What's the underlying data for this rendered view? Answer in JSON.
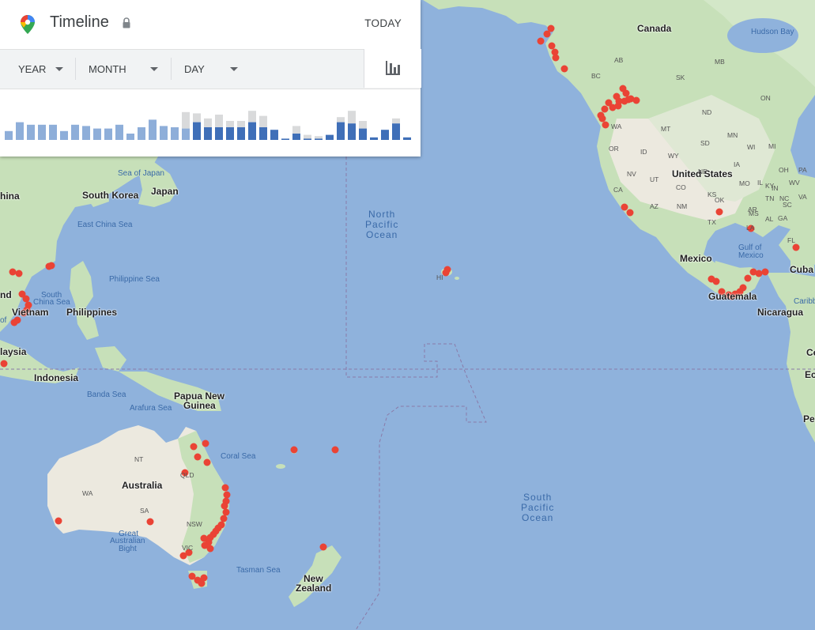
{
  "header": {
    "title": "Timeline",
    "today_label": "TODAY"
  },
  "filters": {
    "year": "YEAR",
    "month": "MONTH",
    "day": "DAY"
  },
  "colors": {
    "ocean": "#8fb2dc",
    "land": "#c7e0b9",
    "land_dry": "#ece9df",
    "marker": "#ea4335",
    "bar_dark": "#3f6fb8",
    "bar_light": "#8eaed9",
    "bar_gray": "#d9dadb"
  },
  "chart_data": {
    "type": "bar",
    "categories": [],
    "series": [
      {
        "values": [
          7,
          14,
          12,
          12,
          12,
          7,
          12,
          11,
          9,
          9,
          12,
          5,
          10,
          16,
          11,
          10,
          9,
          14,
          10,
          10,
          10,
          10,
          14,
          10,
          8,
          1,
          5,
          1,
          1,
          4,
          14,
          13,
          9,
          2,
          8,
          13,
          2
        ]
      },
      {
        "values": [
          0,
          0,
          0,
          0,
          0,
          0,
          0,
          0,
          0,
          0,
          0,
          0,
          0,
          0,
          0,
          0,
          13,
          7,
          7,
          10,
          5,
          5,
          9,
          9,
          0,
          0,
          6,
          3,
          2,
          0,
          4,
          10,
          6,
          0,
          0,
          4,
          0
        ]
      }
    ]
  },
  "labels": {
    "countries": [
      {
        "t": "Canada"
      },
      {
        "t": "United States"
      },
      {
        "t": "Mexico"
      },
      {
        "t": "Cuba"
      },
      {
        "t": "Guatemala"
      },
      {
        "t": "Nicaragua"
      },
      {
        "t": "Ecuador"
      },
      {
        "t": "Pe"
      },
      {
        "t": "Co"
      },
      {
        "t": "Caribb"
      },
      {
        "t": "South Korea"
      },
      {
        "t": "Japan"
      },
      {
        "t": "hina"
      },
      {
        "t": "Philippines"
      },
      {
        "t": "Vietnam"
      },
      {
        "t": "laysia"
      },
      {
        "t": "Indonesia"
      },
      {
        "t": "Papua New"
      },
      {
        "t": "Guinea"
      },
      {
        "t": "Australia"
      },
      {
        "t": "New"
      },
      {
        "t": "Zealand"
      },
      {
        "t": "nd"
      }
    ],
    "seas": [
      {
        "t": "Hudson Bay"
      },
      {
        "t": "Sea of Japan"
      },
      {
        "t": "East China Sea"
      },
      {
        "t": "Philippine Sea"
      },
      {
        "t": "South"
      },
      {
        "t": "China Sea"
      },
      {
        "t": "Banda Sea"
      },
      {
        "t": "Arafura Sea"
      },
      {
        "t": "Coral Sea"
      },
      {
        "t": "Tasman Sea"
      },
      {
        "t": "Great"
      },
      {
        "t": "Australian"
      },
      {
        "t": "Bight"
      },
      {
        "t": "Gulf of"
      },
      {
        "t": "Mexico"
      },
      {
        "t": "of"
      }
    ],
    "oceans": [
      {
        "t": "North\nPacific\nOcean"
      },
      {
        "t": "South\nPacific\nOcean"
      }
    ],
    "states": [
      {
        "t": "AB"
      },
      {
        "t": "SK"
      },
      {
        "t": "MB"
      },
      {
        "t": "ON"
      },
      {
        "t": "BC"
      },
      {
        "t": "WA"
      },
      {
        "t": "MT"
      },
      {
        "t": "ND"
      },
      {
        "t": "MN"
      },
      {
        "t": "OR"
      },
      {
        "t": "ID"
      },
      {
        "t": "WY"
      },
      {
        "t": "SD"
      },
      {
        "t": "WI"
      },
      {
        "t": "MI"
      },
      {
        "t": "NE"
      },
      {
        "t": "IA"
      },
      {
        "t": "NV"
      },
      {
        "t": "UT"
      },
      {
        "t": "CO"
      },
      {
        "t": "KS"
      },
      {
        "t": "MO"
      },
      {
        "t": "IL"
      },
      {
        "t": "IN"
      },
      {
        "t": "OH"
      },
      {
        "t": "PA"
      },
      {
        "t": "CA"
      },
      {
        "t": "AZ"
      },
      {
        "t": "NM"
      },
      {
        "t": "OK"
      },
      {
        "t": "AR"
      },
      {
        "t": "TN"
      },
      {
        "t": "KY"
      },
      {
        "t": "WV"
      },
      {
        "t": "VA"
      },
      {
        "t": "NC"
      },
      {
        "t": "TX"
      },
      {
        "t": "MS"
      },
      {
        "t": "AL"
      },
      {
        "t": "GA"
      },
      {
        "t": "SC"
      },
      {
        "t": "LA"
      },
      {
        "t": "FL"
      },
      {
        "t": "HI"
      },
      {
        "t": "NT"
      },
      {
        "t": "QLD"
      },
      {
        "t": "WA"
      },
      {
        "t": "SA"
      },
      {
        "t": "NSW"
      },
      {
        "t": "VIC"
      }
    ]
  }
}
